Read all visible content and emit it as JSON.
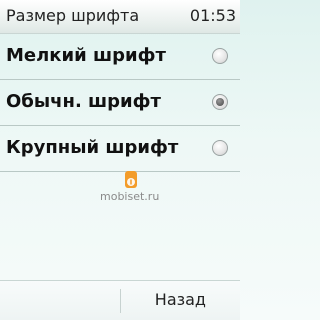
{
  "header": {
    "title": "Размер шрифта",
    "time": "01:53"
  },
  "options": [
    {
      "label": "Мелкий шрифт",
      "selected": false
    },
    {
      "label": "Обычн. шрифт",
      "selected": true
    },
    {
      "label": "Крупный шрифт",
      "selected": false
    }
  ],
  "watermark": {
    "text": "mobiset.ru",
    "logo_color": "#f39c2a"
  },
  "softkeys": {
    "back_label": "Назад"
  }
}
